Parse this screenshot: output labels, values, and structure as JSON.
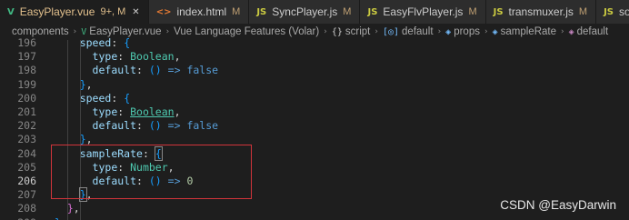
{
  "tabs": [
    {
      "icon": "V",
      "icon_color": "#41b883",
      "name": "EasyPlayer.vue",
      "status": "9+, M",
      "active": true,
      "close": "✕"
    },
    {
      "icon": "<>",
      "icon_color": "#e37933",
      "name": "index.html",
      "status": "M",
      "active": false
    },
    {
      "icon": "JS",
      "icon_color": "#cbcb41",
      "name": "SyncPlayer.js",
      "status": "M",
      "active": false
    },
    {
      "icon": "JS",
      "icon_color": "#cbcb41",
      "name": "EasyFlvPlayer.js",
      "status": "M",
      "active": false
    },
    {
      "icon": "JS",
      "icon_color": "#cbcb41",
      "name": "transmuxer.js",
      "status": "M",
      "active": false
    },
    {
      "icon": "JS",
      "icon_color": "#cbcb41",
      "name": "soundPlay",
      "status": "",
      "active": false
    }
  ],
  "breadcrumb": [
    {
      "icon": "",
      "label": "components"
    },
    {
      "icon": "V",
      "icon_color": "#41b883",
      "label": "EasyPlayer.vue"
    },
    {
      "icon": "",
      "label": "Vue Language Features (Volar)"
    },
    {
      "icon": "{}",
      "icon_color": "#cccccc",
      "label": "script"
    },
    {
      "icon": "[◎]",
      "icon_color": "#75beff",
      "label": "default"
    },
    {
      "icon": "◈",
      "icon_color": "#75beff",
      "label": "props"
    },
    {
      "icon": "◈",
      "icon_color": "#75beff",
      "label": "sampleRate"
    },
    {
      "icon": "◈",
      "icon_color": "#c586c0",
      "label": "default"
    }
  ],
  "editor": {
    "line_numbers": [
      "196",
      "197",
      "198",
      "199",
      "200",
      "201",
      "202",
      "203",
      "204",
      "205",
      "206",
      "207",
      "208",
      "209"
    ],
    "current_line": "206",
    "code": {
      "l196_key": "speed",
      "l196_punct": ": ",
      "l196_brace": "{",
      "l197_key": "type",
      "l197_punct": ": ",
      "l197_type": "Boolean",
      "l197_comma": ",",
      "l198_key": "default",
      "l198_punct": ": ",
      "l198_paren": "()",
      "l198_arrow": " => ",
      "l198_val": "false",
      "l199_brace": "}",
      "l199_comma": ",",
      "l200_key": "speed",
      "l200_punct": ": ",
      "l200_brace": "{",
      "l201_key": "type",
      "l201_punct": ": ",
      "l201_type": "Boolean",
      "l201_comma": ",",
      "l202_key": "default",
      "l202_punct": ": ",
      "l202_paren": "()",
      "l202_arrow": " => ",
      "l202_val": "false",
      "l203_brace": "}",
      "l203_comma": ",",
      "l204_key": "sampleRate",
      "l204_punct": ": ",
      "l204_brace": "{",
      "l205_key": "type",
      "l205_punct": ": ",
      "l205_type": "Number",
      "l205_comma": ",",
      "l206_key": "default",
      "l206_punct": ": ",
      "l206_paren": "()",
      "l206_arrow": " => ",
      "l206_val": "0",
      "l207_brace": "}",
      "l207_comma": ",",
      "l208_brace": "}",
      "l208_comma": ",",
      "l209_brace": "}"
    }
  },
  "watermark": "CSDN @EasyDarwin"
}
